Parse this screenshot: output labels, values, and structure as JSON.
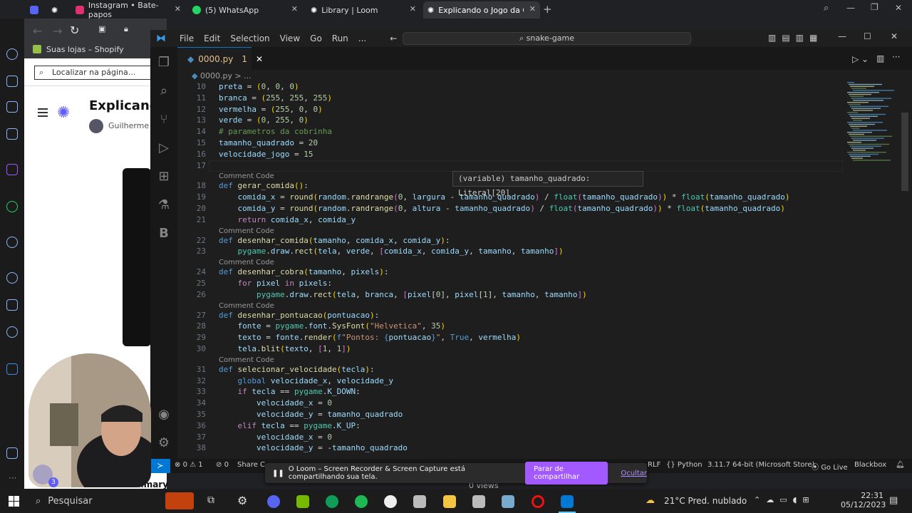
{
  "browser": {
    "tabs": [
      {
        "label": "",
        "icon": "discord-icon",
        "active": false
      },
      {
        "label": "Instagram • Bate-papos",
        "icon": "instagram-icon",
        "active": false
      },
      {
        "label": "(5) WhatsApp",
        "icon": "whatsapp-icon",
        "active": false
      },
      {
        "label": "Library | Loom",
        "icon": "loom-icon",
        "active": false
      },
      {
        "label": "Explicando o Jogo da Cobri",
        "icon": "loom-icon",
        "active": true
      }
    ],
    "bookmark": "Suas lojas – Shopify",
    "find_placeholder": "Localizar na página...",
    "page_title": "Explicando",
    "page_author": "Guilherme C",
    "summary_label": "Summary",
    "views_label": "0 views",
    "notification_badge": "3"
  },
  "vscode": {
    "menu": [
      "File",
      "Edit",
      "Selection",
      "View",
      "Go",
      "Run",
      "..."
    ],
    "search": "snake-game",
    "file_tab": {
      "name": "0000.py",
      "badge": "1"
    },
    "breadcrumb": "0000.py > ...",
    "hover": "(variable) tamanho_quadrado: Literal[20]",
    "lens": "Comment Code",
    "status": {
      "errors": "0",
      "warnings": "1",
      "ports": "0",
      "share": "Share C",
      "eol": "RLF",
      "language": "Python",
      "interpreter": "3.11.7 64-bit (Microsoft Store)",
      "golive": "Go Live",
      "blackbox": "Blackbox"
    }
  },
  "loom_banner": {
    "text": "O Loom – Screen Recorder & Screen Capture está compartilhando sua tela.",
    "share_btn": "Parar de compartilhar",
    "hide_link": "Ocultar"
  },
  "taskbar": {
    "search": "Pesquisar",
    "weather": "21°C  Pred. nublado",
    "time": "22:31",
    "date": "05/12/2023"
  },
  "colors": {
    "accent": "#0078d4",
    "loom": "#a259ff",
    "editor_bg": "#1e1e1e"
  }
}
